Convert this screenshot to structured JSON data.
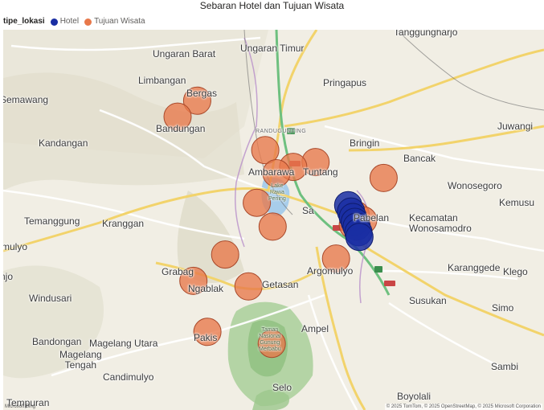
{
  "title": "Sebaran Hotel dan Tujuan Wisata",
  "legend": {
    "title": "tipe_lokasi",
    "items": [
      {
        "label": "Hotel",
        "color": "#1a2ea3"
      },
      {
        "label": "Tujuan Wisata",
        "color": "#e8784a"
      }
    ]
  },
  "places": [
    {
      "id": "tanggungharjo",
      "label": "Tanggungharjo"
    },
    {
      "id": "ungaran-barat",
      "label": "Ungaran Barat"
    },
    {
      "id": "ungaran-timur",
      "label": "Ungaran Timur"
    },
    {
      "id": "limbangan",
      "label": "Limbangan"
    },
    {
      "id": "pringapus",
      "label": "Pringapus"
    },
    {
      "id": "semawang",
      "label": "Semawang"
    },
    {
      "id": "bergas",
      "label": "Bergas"
    },
    {
      "id": "randugunting",
      "label": "RANDUGUNTING"
    },
    {
      "id": "bandungan",
      "label": "Bandungan"
    },
    {
      "id": "juwangi",
      "label": "Juwangi"
    },
    {
      "id": "kandangan",
      "label": "Kandangan"
    },
    {
      "id": "bringin",
      "label": "Bringin"
    },
    {
      "id": "bancak",
      "label": "Bancak"
    },
    {
      "id": "ambarawa",
      "label": "Ambarawa"
    },
    {
      "id": "tuntang",
      "label": "Tuntang"
    },
    {
      "id": "wonosegoro",
      "label": "Wonosegoro"
    },
    {
      "id": "kemusu",
      "label": "Kemusu"
    },
    {
      "id": "temanggung",
      "label": "Temanggung"
    },
    {
      "id": "kranggan",
      "label": "Kranggan"
    },
    {
      "id": "salatiga",
      "label": "Sa"
    },
    {
      "id": "pabelan",
      "label": "Pabelan"
    },
    {
      "id": "kecamatan-wonosamodro",
      "label": "Kecamatan\nWonosamodro"
    },
    {
      "id": "mulyo",
      "label": "mulyo"
    },
    {
      "id": "grabag",
      "label": "Grabag"
    },
    {
      "id": "karanggede",
      "label": "Karanggede"
    },
    {
      "id": "klego",
      "label": "Klego"
    },
    {
      "id": "argomulyo",
      "label": "Argomulyo"
    },
    {
      "id": "ngablak",
      "label": "Ngablak"
    },
    {
      "id": "getasan",
      "label": "Getasan"
    },
    {
      "id": "njo",
      "label": "njo"
    },
    {
      "id": "windusari",
      "label": "Windusari"
    },
    {
      "id": "susukan",
      "label": "Susukan"
    },
    {
      "id": "simo",
      "label": "Simo"
    },
    {
      "id": "ampel",
      "label": "Ampel"
    },
    {
      "id": "bandongan",
      "label": "Bandongan"
    },
    {
      "id": "magelang-utara",
      "label": "Magelang Utara"
    },
    {
      "id": "pakis",
      "label": "Pakis"
    },
    {
      "id": "magelang-tengah",
      "label": "Magelang\nTengah"
    },
    {
      "id": "sambi",
      "label": "Sambi"
    },
    {
      "id": "candimulyo",
      "label": "Candimulyo"
    },
    {
      "id": "selo",
      "label": "Selo"
    },
    {
      "id": "boyolali",
      "label": "Boyolali"
    },
    {
      "id": "tempuran",
      "label": "Tempuran"
    },
    {
      "id": "rawa-pening",
      "label": "Lake\nRawa\nPening"
    },
    {
      "id": "merbabu",
      "label": "Taman\nNasional\nGunung\nMerbabu"
    }
  ],
  "road_labels": [
    "AH2",
    "AH2",
    "AH2",
    "AH2"
  ],
  "points": {
    "hotel": [
      {
        "lat": -7.318,
        "lon": 110.5
      },
      {
        "lat": -7.326,
        "lon": 110.503
      },
      {
        "lat": -7.333,
        "lon": 110.505
      },
      {
        "lat": -7.339,
        "lon": 110.507
      },
      {
        "lat": -7.345,
        "lon": 110.509
      },
      {
        "lat": -7.352,
        "lon": 110.511
      },
      {
        "lat": -7.358,
        "lon": 110.512
      }
    ],
    "wisata": [
      {
        "lat": -7.187,
        "lon": 110.338
      },
      {
        "lat": -7.207,
        "lon": 110.317
      },
      {
        "lat": -7.249,
        "lon": 110.411
      },
      {
        "lat": -7.264,
        "lon": 110.465
      },
      {
        "lat": -7.27,
        "lon": 110.441
      },
      {
        "lat": -7.278,
        "lon": 110.423
      },
      {
        "lat": -7.284,
        "lon": 110.538
      },
      {
        "lat": -7.315,
        "lon": 110.402
      },
      {
        "lat": -7.33,
        "lon": 110.508
      },
      {
        "lat": -7.337,
        "lon": 110.516
      },
      {
        "lat": -7.343,
        "lon": 110.505
      },
      {
        "lat": -7.345,
        "lon": 110.419
      },
      {
        "lat": -7.38,
        "lon": 110.368
      },
      {
        "lat": -7.385,
        "lon": 110.487
      },
      {
        "lat": -7.413,
        "lon": 110.334
      },
      {
        "lat": -7.42,
        "lon": 110.393
      },
      {
        "lat": -7.477,
        "lon": 110.349
      },
      {
        "lat": -7.492,
        "lon": 110.418
      }
    ]
  },
  "attribution": "© 2025 TomTom, © 2025 OpenStreetMap, © 2025 Microsoft Corporation",
  "bing_label": "Microsoft Bing"
}
